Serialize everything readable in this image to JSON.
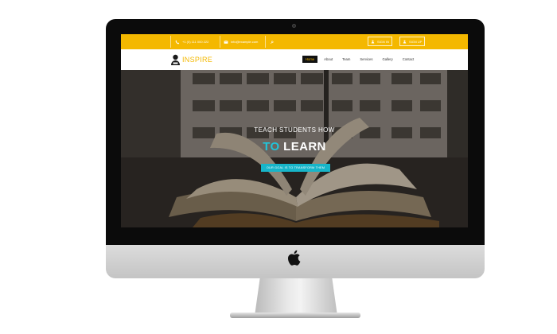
{
  "topbar": {
    "phone": "+1 (0) 111 000 222",
    "email": "info@example.com",
    "signin_label": "SIGN IN",
    "signup_label": "SIGN UP"
  },
  "brand": {
    "name": "INSPIRE"
  },
  "nav": {
    "items": [
      {
        "label": "Home",
        "active": true
      },
      {
        "label": "About",
        "active": false
      },
      {
        "label": "Team",
        "active": false
      },
      {
        "label": "Services",
        "active": false
      },
      {
        "label": "Gallery",
        "active": false
      },
      {
        "label": "Contact",
        "active": false
      }
    ]
  },
  "hero": {
    "line1": "TEACH STUDENTS HOW",
    "line2_highlight": "TO",
    "line2_rest": " LEARN",
    "button_label": "OUR GOAL IS TO TRANSFORM THEM"
  },
  "icons": {
    "phone": "phone-icon",
    "email": "envelope-icon",
    "extra": "wrench-icon",
    "signin": "user-icon",
    "signup": "user-icon",
    "logo": "student-icon",
    "monitor_logo": "apple-logo-icon"
  },
  "colors": {
    "accent": "#f4b800",
    "cyan": "#20c4da",
    "button": "#17b5c9",
    "active_nav_bg": "#111111"
  }
}
